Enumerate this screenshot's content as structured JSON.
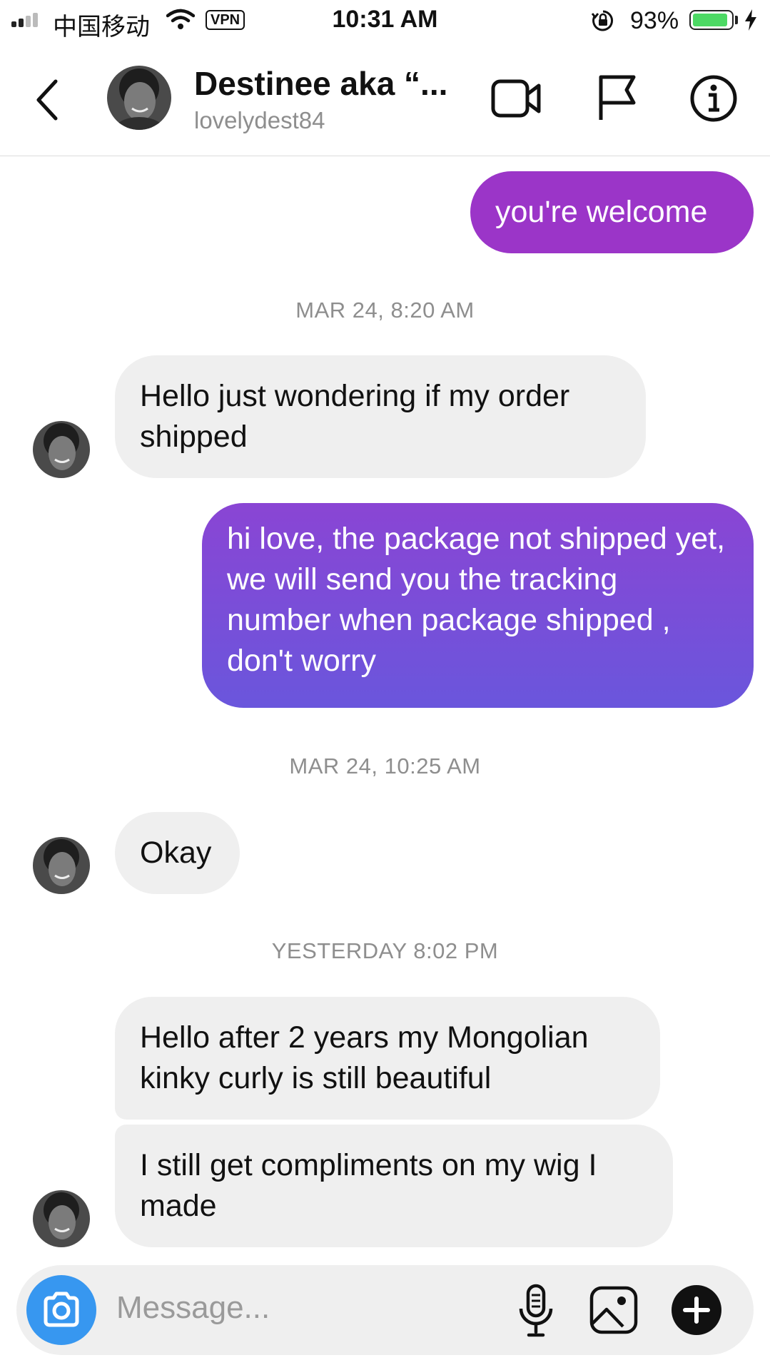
{
  "status_bar": {
    "carrier": "中国移动",
    "vpn": "VPN",
    "time": "10:31 AM",
    "battery": "93%",
    "battery_level": 0.93,
    "battery_color": "#4cd964"
  },
  "header": {
    "name": "Destinee aka “...",
    "username": "lovelydest84",
    "icons": [
      "back-icon",
      "video-call-icon",
      "flag-icon",
      "info-icon"
    ]
  },
  "colors": {
    "incoming_bubble": "#efefef",
    "outgoing_gradient_top": "#9b35c8",
    "outgoing_gradient_bottom": "#6a56dc",
    "camera_button": "#3797f0"
  },
  "messages": {
    "m1": "you're welcome",
    "ts1": "MAR 24, 8:20 AM",
    "m2": "Hello just wondering if my order shipped",
    "m3": "hi love, the package not shipped yet, we will send you the tracking number when package shipped , don't worry",
    "ts2": "MAR 24, 10:25 AM",
    "m4": "Okay",
    "ts3": "YESTERDAY 8:02 PM",
    "m5": "Hello after 2 years my Mongolian kinky curly is still beautiful",
    "m6": "I still get compliments on my wig I made"
  },
  "composer": {
    "placeholder": "Message...",
    "icons": [
      "camera-icon",
      "microphone-icon",
      "gallery-icon",
      "plus-icon"
    ]
  }
}
